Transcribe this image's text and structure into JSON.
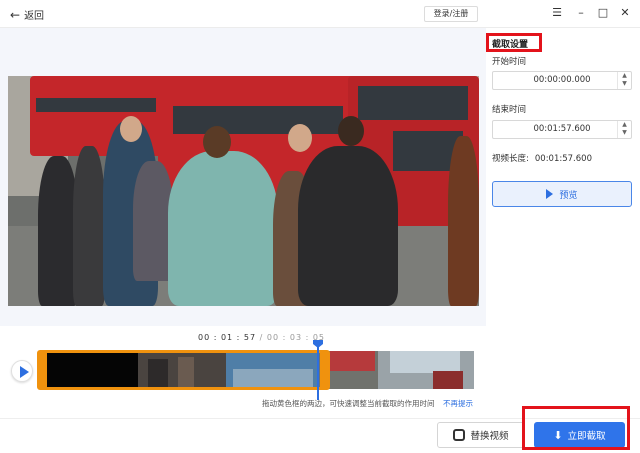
{
  "titlebar": {
    "back_label": "返回",
    "login_label": "登录/注册"
  },
  "settings": {
    "title": "截取设置",
    "start_label": "开始时间",
    "start_value": "00:00:00.000",
    "end_label": "结束时间",
    "end_value": "00:01:57.600",
    "duration_label": "视频长度:",
    "duration_value": "00:01:57.600",
    "preview_label": "预览"
  },
  "timeline": {
    "current": "00 : 01 : 57",
    "total": " / 00 : 03 : 05",
    "hint": "拖动黄色框的两边，可快速调整当前截取的作用时间",
    "hint_link": "不再提示"
  },
  "actions": {
    "replace_label": "替换视频",
    "export_label": "立即截取"
  },
  "colors": {
    "accent": "#2f74ea",
    "selection": "#f0920e",
    "annotation": "#e3131b"
  }
}
